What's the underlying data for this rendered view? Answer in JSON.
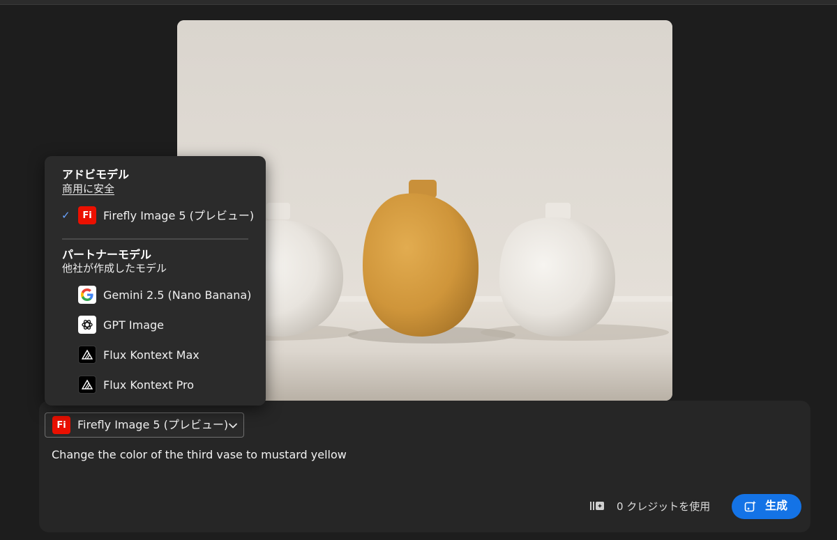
{
  "menu": {
    "adobe_section": {
      "title": "アドビモデル",
      "subtitle": "商用に安全"
    },
    "adobe_items": [
      {
        "label": "Firefly Image 5 (プレビュー)",
        "icon": "firefly-icon",
        "icon_text": "Fi",
        "selected": true
      }
    ],
    "check_glyph": "✓",
    "partner_section": {
      "title": "パートナーモデル",
      "subtitle": "他社が作成したモデル"
    },
    "partner_items": [
      {
        "label": "Gemini 2.5 (Nano Banana)",
        "icon": "google-icon"
      },
      {
        "label": "GPT Image",
        "icon": "openai-icon"
      },
      {
        "label": "Flux Kontext Max",
        "icon": "flux-icon"
      },
      {
        "label": "Flux Kontext Pro",
        "icon": "flux-icon"
      }
    ]
  },
  "prompt_panel": {
    "model_select": {
      "icon_text": "Fi",
      "value": "Firefly Image 5 (プレビュー)"
    },
    "prompt_text": "Change the color of the third vase to mustard yellow",
    "credits_text": "0 クレジットを使用",
    "generate_label": "生成"
  },
  "colors": {
    "background": "#1d1d1d",
    "panel": "#262626",
    "menu": "#2b2b2b",
    "accent_blue": "#1473e6",
    "check_blue": "#6aa4ff",
    "firefly_red": "#eb1000",
    "vase_white": "#ece9e4",
    "vase_mustard": "#d49a3f"
  }
}
